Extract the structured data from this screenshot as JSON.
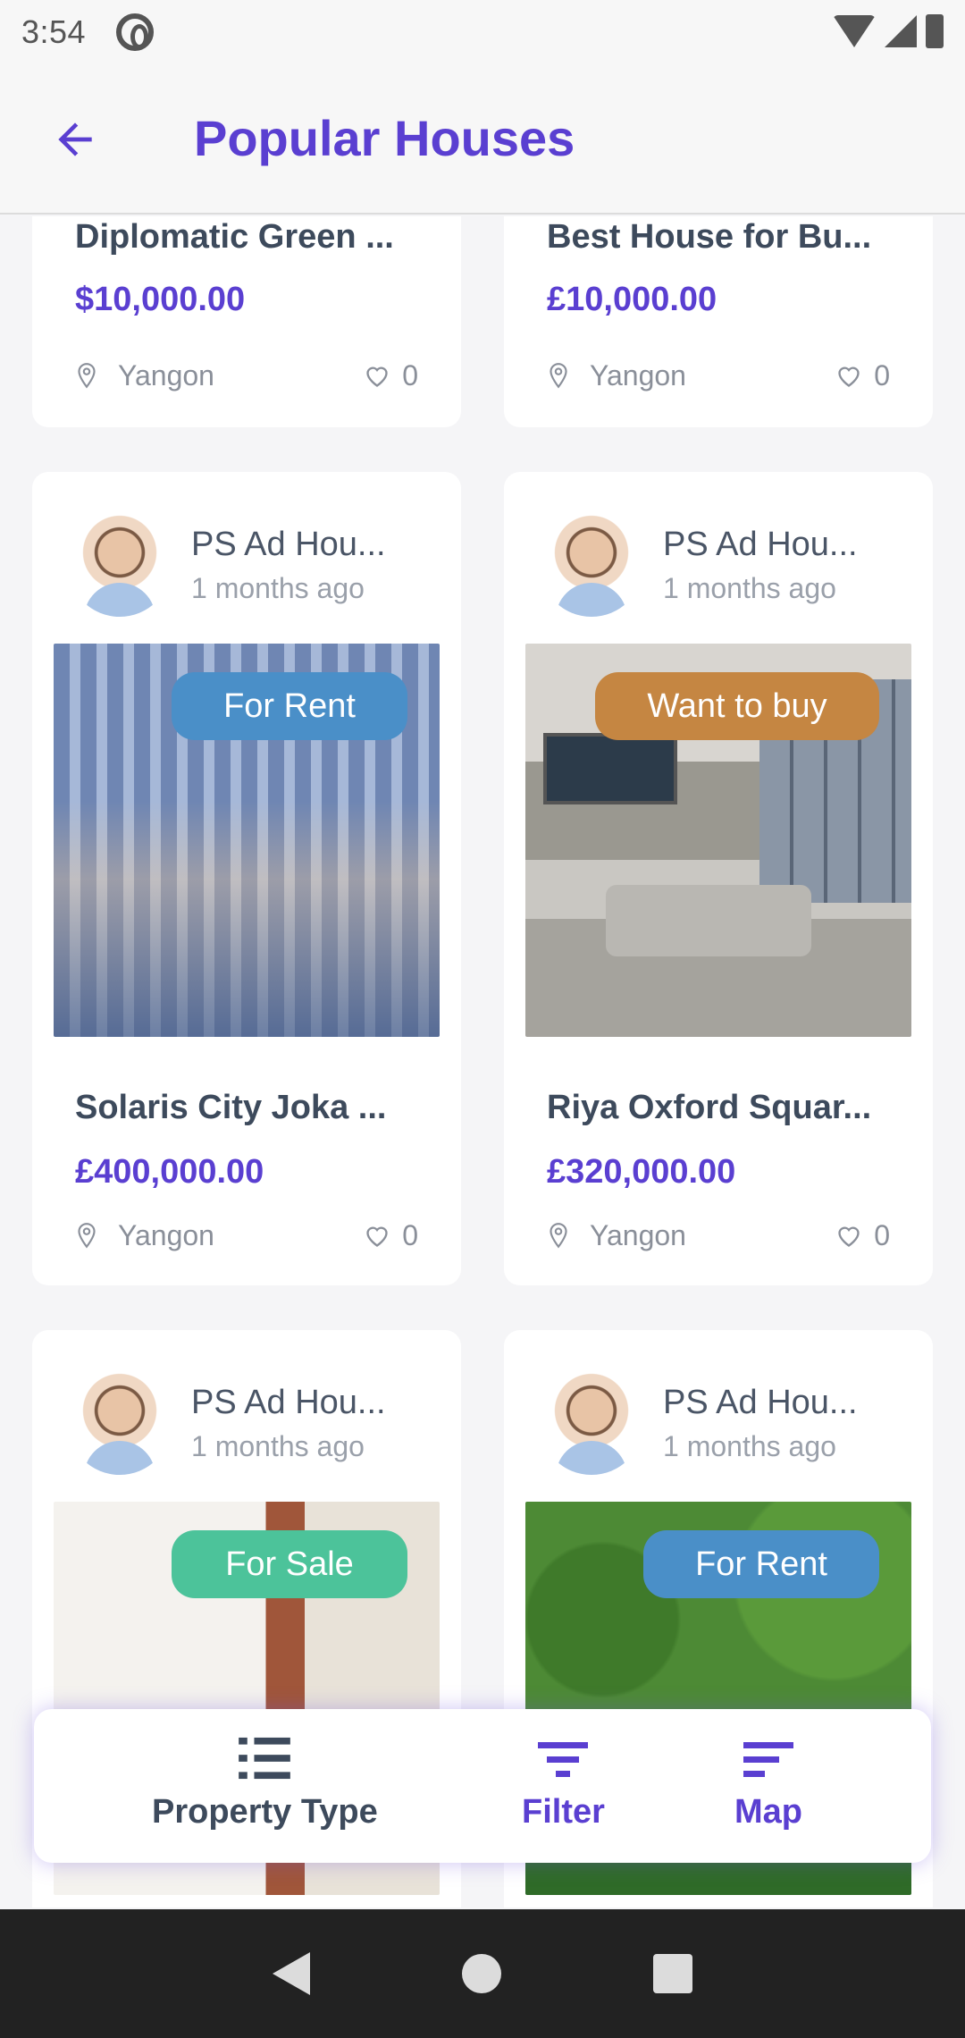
{
  "status_bar": {
    "time": "3:54"
  },
  "header": {
    "title": "Popular Houses"
  },
  "listings": [
    {
      "title": "Diplomatic Green ...",
      "price": "$10,000.00",
      "location": "Yangon",
      "likes": "0"
    },
    {
      "title": "Best House for Bu...",
      "price": "£10,000.00",
      "location": "Yangon",
      "likes": "0"
    },
    {
      "poster": "PS Ad Hou...",
      "posted": "1 months ago",
      "badge": "For Rent",
      "badge_color": "#4a8fc8",
      "title": "Solaris City Joka ...",
      "price": "£400,000.00",
      "location": "Yangon",
      "likes": "0"
    },
    {
      "poster": "PS Ad Hou...",
      "posted": "1 months ago",
      "badge": "Want to buy",
      "badge_color": "#c58642",
      "title": "Riya Oxford Squar...",
      "price": "£320,000.00",
      "location": "Yangon",
      "likes": "0"
    },
    {
      "poster": "PS Ad Hou...",
      "posted": "1 months ago",
      "badge": "For Sale",
      "badge_color": "#4cc39a"
    },
    {
      "poster": "PS Ad Hou...",
      "posted": "1 months ago",
      "badge": "For Rent",
      "badge_color": "#4a8fc8"
    }
  ],
  "bottom_actions": {
    "property_type": {
      "label": "Property Type",
      "icon": "list-icon"
    },
    "filter": {
      "label": "Filter",
      "icon": "filter-icon"
    },
    "map": {
      "label": "Map",
      "icon": "map-lines-icon"
    }
  },
  "colors": {
    "accent": "#5a3fd1",
    "text_dark": "#3d4a5c",
    "text_muted": "#8a8f99"
  }
}
